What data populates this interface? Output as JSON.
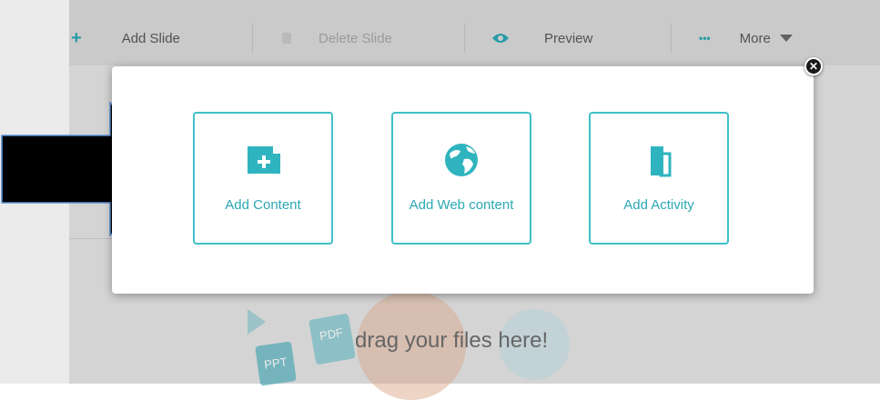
{
  "toolbar": {
    "add_slide_icon": "+",
    "add_slide": "Add Slide",
    "delete_slide": "Delete Slide",
    "preview": "Preview",
    "more_icon": "•••",
    "more": "More"
  },
  "dropzone": {
    "text": "drag your files here!",
    "ppt_label": "PPT",
    "pdf_label": "PDF"
  },
  "modal": {
    "close_icon": "✕",
    "cards": [
      {
        "label": "Add Content",
        "icon": "file-plus-icon"
      },
      {
        "label": "Add Web content",
        "icon": "globe-icon"
      },
      {
        "label": "Add Activity",
        "icon": "pages-icon"
      }
    ]
  },
  "colors": {
    "accent": "#3ec0c7",
    "accent_text": "#2ba8b4",
    "arrow": "#000000"
  }
}
